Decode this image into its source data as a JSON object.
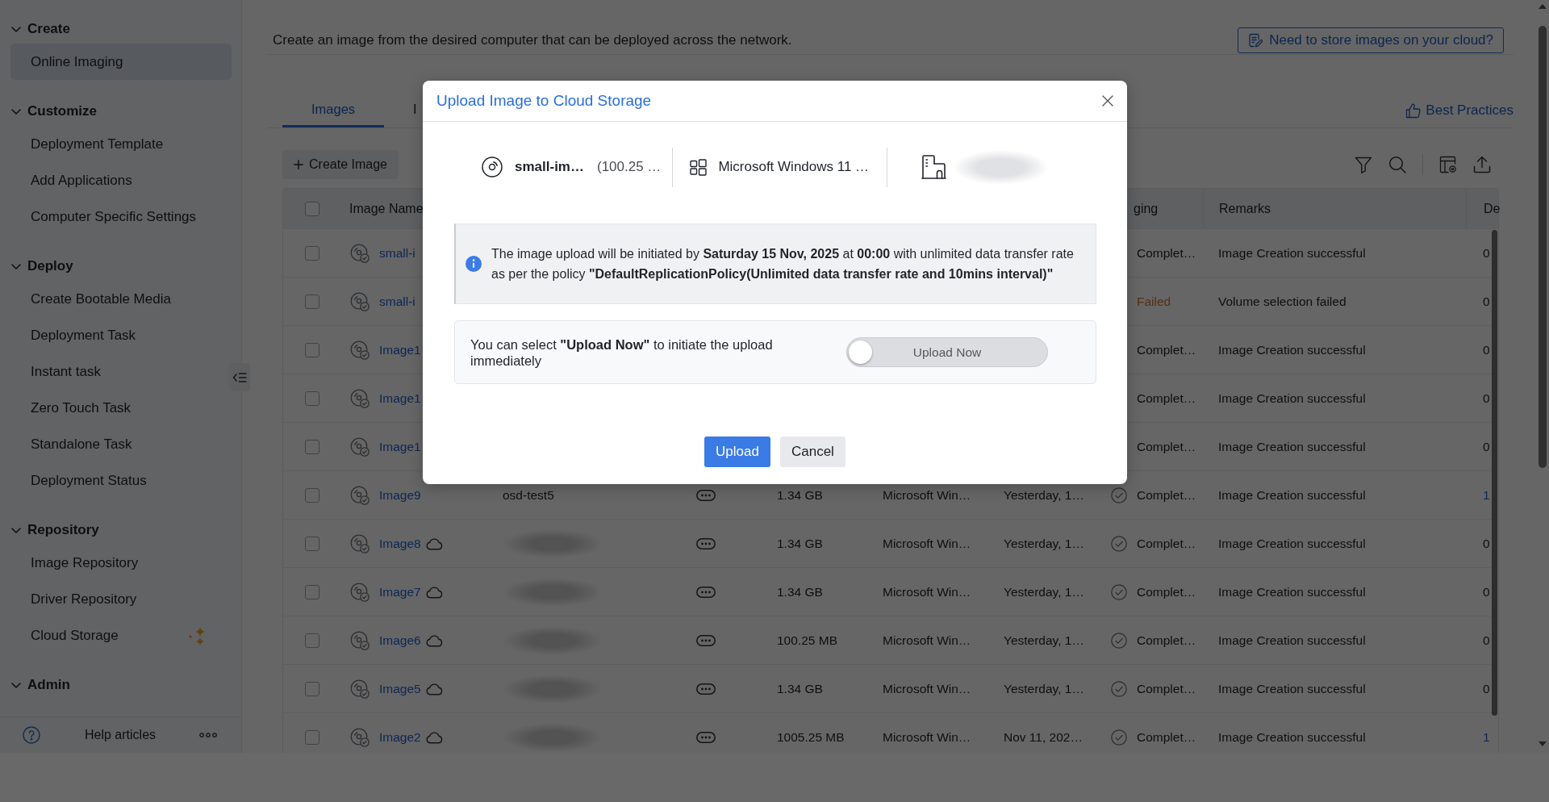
{
  "sidebar": {
    "sections": [
      {
        "title": "Create",
        "expanded": true,
        "items": [
          {
            "label": "Online Imaging",
            "selected": true,
            "new": false
          }
        ]
      },
      {
        "title": "Customize",
        "expanded": true,
        "items": [
          {
            "label": "Deployment Template",
            "selected": false,
            "new": false
          },
          {
            "label": "Add Applications",
            "selected": false,
            "new": false
          },
          {
            "label": "Computer Specific Settings",
            "selected": false,
            "new": false
          }
        ]
      },
      {
        "title": "Deploy",
        "expanded": true,
        "items": [
          {
            "label": "Create Bootable Media",
            "selected": false,
            "new": false
          },
          {
            "label": "Deployment Task",
            "selected": false,
            "new": false
          },
          {
            "label": "Instant task",
            "selected": false,
            "new": false
          },
          {
            "label": "Zero Touch Task",
            "selected": false,
            "new": false
          },
          {
            "label": "Standalone Task",
            "selected": false,
            "new": false
          },
          {
            "label": "Deployment Status",
            "selected": false,
            "new": false
          }
        ]
      },
      {
        "title": "Repository",
        "expanded": true,
        "items": [
          {
            "label": "Image Repository",
            "selected": false,
            "new": false
          },
          {
            "label": "Driver Repository",
            "selected": false,
            "new": false
          },
          {
            "label": "Cloud Storage",
            "selected": false,
            "new": true
          }
        ]
      },
      {
        "title": "Admin",
        "expanded": true
      }
    ],
    "help": "Help articles"
  },
  "header": {
    "description": "Create an image from the desired computer that can be deployed across the network.",
    "cloud_link": "Need to store images on your cloud?"
  },
  "tabs": [
    {
      "label": "Images",
      "selected": true
    },
    {
      "label": "I",
      "selected": false
    }
  ],
  "best_practices": "Best Practices",
  "toolbar": {
    "create_button": "Create Image"
  },
  "table": {
    "select_all": {
      "checked": false
    },
    "columns": {
      "image_name": "Image Name",
      "column_8": "ging",
      "remarks": "Remarks",
      "column_10": "De"
    },
    "rows": [
      {
        "checked": false,
        "name": "small-i",
        "status": {
          "kind": "complete",
          "label": "Complet…"
        },
        "remarks": "Image Creation successful",
        "column_10": {
          "text": "0",
          "link": false
        }
      },
      {
        "checked": false,
        "name": "small-i",
        "status": {
          "kind": "failed",
          "label": "Failed"
        },
        "remarks": "Volume selection failed",
        "column_10": {
          "text": "0",
          "link": false
        }
      },
      {
        "checked": false,
        "name": "Image1",
        "status": {
          "kind": "complete",
          "label": "Complet…"
        },
        "remarks": "Image Creation successful",
        "column_10": {
          "text": "0",
          "link": false
        }
      },
      {
        "checked": false,
        "name": "Image1",
        "status": {
          "kind": "complete",
          "label": "Complet…"
        },
        "remarks": "Image Creation successful",
        "column_10": {
          "text": "0",
          "link": false
        }
      },
      {
        "checked": false,
        "name": "Image1",
        "status": {
          "kind": "complete",
          "label": "Complet…"
        },
        "remarks": "Image Creation successful",
        "column_10": {
          "text": "0",
          "link": false
        }
      },
      {
        "checked": false,
        "name": "Image9",
        "in_cloud": false,
        "column_3_redacted": false,
        "column_3": "osd-test5",
        "size": "1.34 GB",
        "os": "Microsoft Win…",
        "date": "Yesterday, 1…",
        "status": {
          "kind": "complete",
          "label": "Complet…"
        },
        "remarks": "Image Creation successful",
        "column_10": {
          "text": "1",
          "link": true
        }
      },
      {
        "checked": false,
        "name": "Image8",
        "in_cloud": true,
        "column_3_redacted": true,
        "size": "1.34 GB",
        "os": "Microsoft Win…",
        "date": "Yesterday, 1…",
        "status": {
          "kind": "complete",
          "label": "Complet…"
        },
        "remarks": "Image Creation successful",
        "column_10": {
          "text": "0",
          "link": false
        }
      },
      {
        "checked": false,
        "name": "Image7",
        "in_cloud": true,
        "column_3_redacted": true,
        "size": "1.34 GB",
        "os": "Microsoft Win…",
        "date": "Yesterday, 1…",
        "status": {
          "kind": "complete",
          "label": "Complet…"
        },
        "remarks": "Image Creation successful",
        "column_10": {
          "text": "0",
          "link": false
        }
      },
      {
        "checked": false,
        "name": "Image6",
        "in_cloud": true,
        "column_3_redacted": true,
        "size": "100.25 MB",
        "os": "Microsoft Win…",
        "date": "Yesterday, 1…",
        "status": {
          "kind": "complete",
          "label": "Complet…"
        },
        "remarks": "Image Creation successful",
        "column_10": {
          "text": "0",
          "link": false
        }
      },
      {
        "checked": false,
        "name": "Image5",
        "in_cloud": true,
        "column_3_redacted": true,
        "size": "1.34 GB",
        "os": "Microsoft Win…",
        "date": "Yesterday, 1…",
        "status": {
          "kind": "complete",
          "label": "Complet…"
        },
        "remarks": "Image Creation successful",
        "column_10": {
          "text": "0",
          "link": false
        }
      },
      {
        "checked": false,
        "name": "Image2",
        "in_cloud": true,
        "column_3_redacted": true,
        "size": "1005.25 MB",
        "os": "Microsoft Win…",
        "date": "Nov 11, 202…",
        "status": {
          "kind": "complete",
          "label": "Complet…"
        },
        "remarks": "Image Creation successful",
        "column_10": {
          "text": "1",
          "link": true
        }
      }
    ]
  },
  "dialog": {
    "title": "Upload Image to Cloud Storage",
    "image_name": "small-im…",
    "image_size": "(100.25 …",
    "os": "Microsoft Windows 11 …",
    "destination_redacted": true,
    "notice": "The image upload will be initiated by **Saturday 15 Nov, 2025** at **00:00** with unlimited data transfer rate as per the policy **\"DefaultReplicationPolicy(Unlimited data transfer rate and 10mins interval)\"**",
    "upload_now": {
      "hint": "You can select **\"Upload Now\"** to initiate the upload immediately",
      "label": "Upload Now",
      "on": false
    },
    "buttons": [
      {
        "label": "Upload",
        "kind": "primary"
      },
      {
        "label": "Cancel",
        "kind": "secondary"
      }
    ]
  }
}
